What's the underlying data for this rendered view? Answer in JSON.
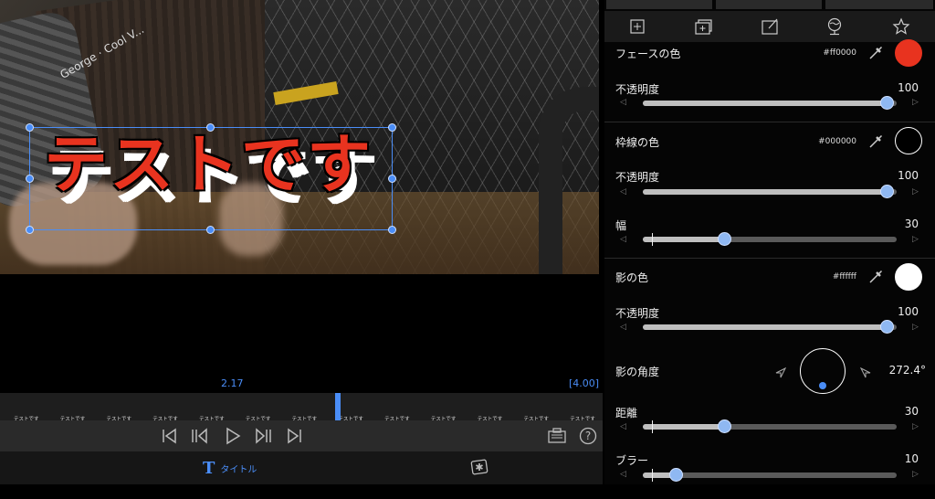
{
  "preview": {
    "overlay_text": "テストです",
    "watermark": "George · Cool V..."
  },
  "timeline": {
    "current_time": "2.17",
    "total_time": "[4.00]",
    "clip_label": "テストです",
    "clip_count": 13
  },
  "bottom_bar": {
    "title_tab_icon": "T",
    "title_tab_label": "タイトル"
  },
  "panel": {
    "face": {
      "label": "フェースの色",
      "hex": "#ff0000",
      "color": "#e8331f"
    },
    "face_opacity": {
      "label": "不透明度",
      "value": "100",
      "fraction": 0.96
    },
    "stroke": {
      "label": "枠線の色",
      "hex": "#000000",
      "color": "#000000"
    },
    "stroke_opacity": {
      "label": "不透明度",
      "value": "100",
      "fraction": 0.96
    },
    "stroke_width": {
      "label": "幅",
      "value": "30",
      "fraction": 0.32
    },
    "shadow": {
      "label": "影の色",
      "hex": "#ffffff",
      "color": "#ffffff"
    },
    "shadow_opacity": {
      "label": "不透明度",
      "value": "100",
      "fraction": 0.96
    },
    "shadow_angle": {
      "label": "影の角度",
      "value": "272.4°"
    },
    "distance": {
      "label": "距離",
      "value": "30",
      "fraction": 0.32
    },
    "blur": {
      "label": "ブラー",
      "value": "10",
      "fraction": 0.13
    }
  },
  "colors": {
    "accent": "#4a8df7",
    "panel_bg": "#050505"
  }
}
